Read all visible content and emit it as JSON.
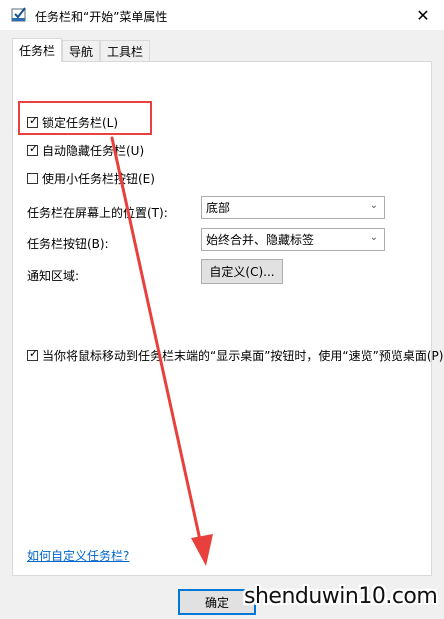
{
  "window": {
    "title": "任务栏和“开始”菜单属性"
  },
  "tabs": [
    {
      "label": "任务栏",
      "active": true
    },
    {
      "label": "导航",
      "active": false
    },
    {
      "label": "工具栏",
      "active": false
    }
  ],
  "options": {
    "lock_taskbar": {
      "label": "锁定任务栏(L)",
      "checked": true
    },
    "auto_hide": {
      "label": "自动隐藏任务栏(U)",
      "checked": true
    },
    "small_buttons": {
      "label": "使用小任务栏按钮(E)",
      "checked": false
    },
    "peek": {
      "label": "当你将鼠标移动到任务栏末端的“显示桌面”按钮时，使用“速览”预览桌面(P)",
      "checked": true
    }
  },
  "position": {
    "label": "任务栏在屏幕上的位置(T):",
    "value": "底部"
  },
  "buttons_combine": {
    "label": "任务栏按钮(B):",
    "value": "始终合并、隐藏标签"
  },
  "notification": {
    "label": "通知区域:",
    "button": "自定义(C)..."
  },
  "help_link": "如何自定义任务栏?",
  "footer": {
    "ok": "确定"
  },
  "watermark": "shenduwin10.com",
  "colors": {
    "highlight": "#e8403c",
    "link": "#0066cc",
    "focus": "#0078d7"
  }
}
